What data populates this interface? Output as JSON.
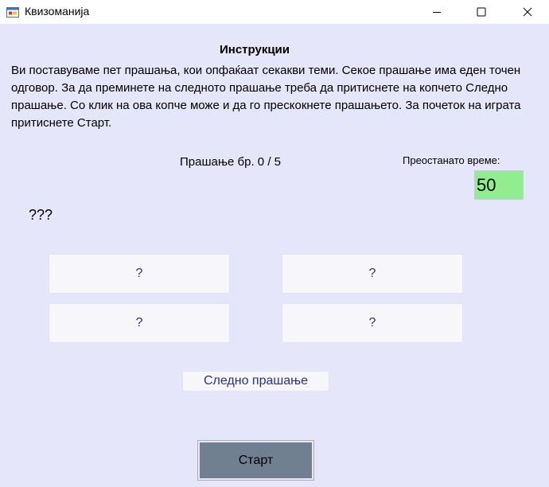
{
  "window": {
    "title": "Квизоманија",
    "icon": "app-form-icon",
    "controls": [
      "minimize-icon",
      "maximize-icon",
      "close-icon"
    ]
  },
  "instructions": {
    "heading": "Инструкции",
    "text": "Ви поставуваме пет прашања, кои опфаќаат секакви теми. Секое прашање има еден точен одговор. За да преминете на следното прашање треба да притиснете на копчето Следно прашање. Со клик на ова копче може и да го прескокнете прашањето. За почеток на играта притиснете Старт."
  },
  "quiz": {
    "question_counter": "Прашање бр. 0 / 5",
    "time_label": "Преостанато време:",
    "timer_value": "50",
    "question": "???",
    "answers": [
      "?",
      "?",
      "?",
      "?"
    ],
    "next_label": "Следно прашање",
    "start_label": "Старт"
  },
  "colors": {
    "background": "#e6e6fa",
    "timer_background": "#90ee90",
    "start_button": "#708090",
    "button_text": "#2e2e8a"
  }
}
